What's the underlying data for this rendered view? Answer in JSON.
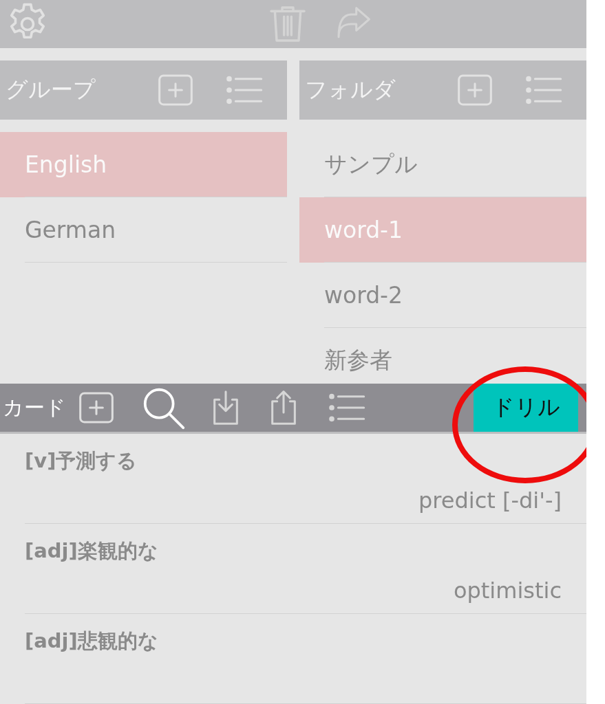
{
  "toolbar": {
    "trash_disabled": true,
    "forward_disabled": true
  },
  "groups": {
    "title": "グループ",
    "items": [
      {
        "label": "English",
        "selected": true
      },
      {
        "label": "German",
        "selected": false
      }
    ]
  },
  "folders": {
    "title": "フォルダ",
    "items": [
      {
        "label": "サンプル",
        "selected": false
      },
      {
        "label": "word-1",
        "selected": true
      },
      {
        "label": "word-2",
        "selected": false
      },
      {
        "label": "新参者",
        "selected": false
      }
    ]
  },
  "cards_bar": {
    "title": "カード",
    "drill_button": "ドリル"
  },
  "cards": [
    {
      "meaning": "[v]予測する",
      "word": "predict [-di'-]"
    },
    {
      "meaning": "[adj]楽観的な",
      "word": "optimistic"
    },
    {
      "meaning": "[adj]悲観的な"
    }
  ]
}
